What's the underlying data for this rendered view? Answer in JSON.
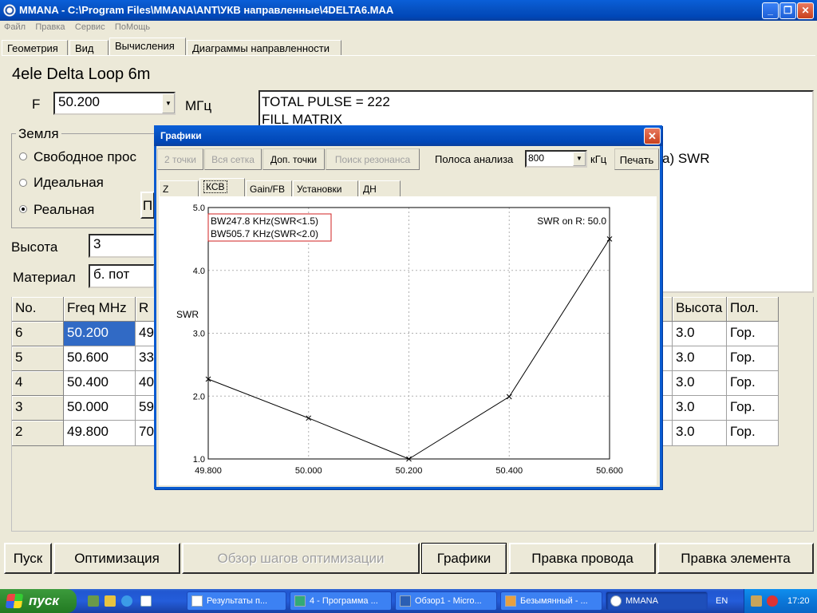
{
  "window": {
    "title": "MMANA - C:\\Program Files\\MMANA\\ANT\\УКВ направленные\\4DELTA6.MAA",
    "minimize": "_",
    "maximize": "❐",
    "close": "✕"
  },
  "menu": [
    "Файл",
    "Правка",
    "Сервис",
    "ПоМощь"
  ],
  "tabs": [
    "Геометрия",
    "Вид",
    "Вычисления",
    "Диаграммы направленности"
  ],
  "active_tab": "Вычисления",
  "antenna_name": "4ele Delta Loop 6m",
  "freq": {
    "label": "F",
    "value": "50.200",
    "unit": "МГц"
  },
  "ground": {
    "title": "Земля",
    "options": [
      "Свободное прос",
      "Идеальная",
      "Реальная"
    ],
    "selected": "Реальная",
    "hidden_button": "П"
  },
  "height": {
    "label": "Высота",
    "value": "3"
  },
  "material": {
    "label": "Материал",
    "value": "б. пот"
  },
  "output_text": [
    "TOTAL PULSE = 222",
    "FILL MATRIX"
  ],
  "output_partial": "а)  SWR",
  "table": {
    "headers_left": [
      "No.",
      "Freq MHz",
      "R"
    ],
    "headers_right": [
      "Высота",
      "Пол."
    ],
    "rows": [
      {
        "no": "6",
        "freq": "50.200",
        "r": "49",
        "height": "3.0",
        "pol": "Гор."
      },
      {
        "no": "5",
        "freq": "50.600",
        "r": "33",
        "height": "3.0",
        "pol": "Гор."
      },
      {
        "no": "4",
        "freq": "50.400",
        "r": "40",
        "height": "3.0",
        "pol": "Гор."
      },
      {
        "no": "3",
        "freq": "50.000",
        "r": "59",
        "height": "3.0",
        "pol": "Гор."
      },
      {
        "no": "2",
        "freq": "49.800",
        "r": "70",
        "height": "3.0",
        "pol": "Гор."
      }
    ]
  },
  "buttons": {
    "start": "Пуск",
    "optimize": "Оптимизация",
    "review": "Обзор шагов оптимизации",
    "graphs": "Графики",
    "edit_wire": "Правка провода",
    "edit_element": "Правка элемента"
  },
  "dialog": {
    "title": "Графики",
    "close": "✕",
    "toolbar": {
      "two_points": "2 точки",
      "full_grid": "Вся сетка",
      "extra_points": "Доп. точки",
      "resonance": "Поиск резонанса",
      "band_label": "Полоса анализа",
      "band_value": "800",
      "band_unit": "кГц",
      "print": "Печать"
    },
    "tabs": [
      "Z",
      "КСВ",
      "Gain/FB",
      "Установки",
      "ДН"
    ],
    "active_tab": "КСВ",
    "bw_lines": [
      "BW247.8 KHz(SWR<1.5)",
      "BW505.7 KHz(SWR<2.0)"
    ],
    "swr_note": "SWR on R: 50.0"
  },
  "chart_data": {
    "type": "line",
    "ylabel": "SWR",
    "x": [
      49.8,
      50.0,
      50.2,
      50.4,
      50.6
    ],
    "x_ticks": [
      "49.800",
      "50.000",
      "50.200",
      "50.400",
      "50.600"
    ],
    "y_ticks": [
      "1.0",
      "2.0",
      "3.0",
      "4.0",
      "5.0"
    ],
    "values": [
      2.27,
      1.65,
      1.0,
      1.99,
      4.5
    ],
    "xlim": [
      49.8,
      50.6
    ],
    "ylim": [
      1.0,
      5.0
    ],
    "grid": true
  },
  "taskbar": {
    "start": "пуск",
    "tasks": [
      "Результаты п...",
      "4 - Программа ...",
      "Обзор1 - Micro...",
      "Безымянный - ...",
      "MMANA"
    ],
    "active_task": "MMANA",
    "lang": "EN",
    "clock": "17:20"
  }
}
